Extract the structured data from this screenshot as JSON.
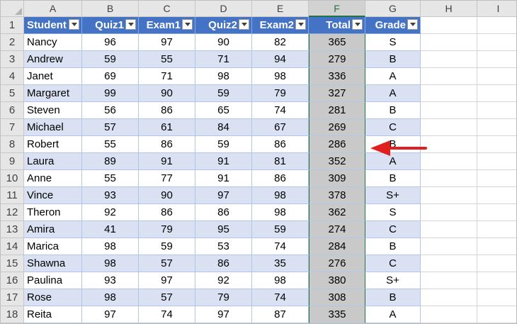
{
  "columns": [
    "A",
    "B",
    "C",
    "D",
    "E",
    "F",
    "G",
    "H",
    "I"
  ],
  "selected_column": "F",
  "headers": [
    "Student",
    "Quiz1",
    "Exam1",
    "Quiz2",
    "Exam2",
    "Total",
    "Grade"
  ],
  "rows": [
    {
      "n": "2",
      "name": "Nancy",
      "q1": "96",
      "e1": "97",
      "q2": "90",
      "e2": "82",
      "total": "365",
      "grade": "S"
    },
    {
      "n": "3",
      "name": "Andrew",
      "q1": "59",
      "e1": "55",
      "q2": "71",
      "e2": "94",
      "total": "279",
      "grade": "B"
    },
    {
      "n": "4",
      "name": "Janet",
      "q1": "69",
      "e1": "71",
      "q2": "98",
      "e2": "98",
      "total": "336",
      "grade": "A"
    },
    {
      "n": "5",
      "name": "Margaret",
      "q1": "99",
      "e1": "90",
      "q2": "59",
      "e2": "79",
      "total": "327",
      "grade": "A"
    },
    {
      "n": "6",
      "name": "Steven",
      "q1": "56",
      "e1": "86",
      "q2": "65",
      "e2": "74",
      "total": "281",
      "grade": "B"
    },
    {
      "n": "7",
      "name": "Michael",
      "q1": "57",
      "e1": "61",
      "q2": "84",
      "e2": "67",
      "total": "269",
      "grade": "C"
    },
    {
      "n": "8",
      "name": "Robert",
      "q1": "55",
      "e1": "86",
      "q2": "59",
      "e2": "86",
      "total": "286",
      "grade": "B"
    },
    {
      "n": "9",
      "name": "Laura",
      "q1": "89",
      "e1": "91",
      "q2": "91",
      "e2": "81",
      "total": "352",
      "grade": "A"
    },
    {
      "n": "10",
      "name": "Anne",
      "q1": "55",
      "e1": "77",
      "q2": "91",
      "e2": "86",
      "total": "309",
      "grade": "B"
    },
    {
      "n": "11",
      "name": "Vince",
      "q1": "93",
      "e1": "90",
      "q2": "97",
      "e2": "98",
      "total": "378",
      "grade": "S+"
    },
    {
      "n": "12",
      "name": "Theron",
      "q1": "92",
      "e1": "86",
      "q2": "86",
      "e2": "98",
      "total": "362",
      "grade": "S"
    },
    {
      "n": "13",
      "name": "Amira",
      "q1": "41",
      "e1": "79",
      "q2": "95",
      "e2": "59",
      "total": "274",
      "grade": "C"
    },
    {
      "n": "14",
      "name": "Marica",
      "q1": "98",
      "e1": "59",
      "q2": "53",
      "e2": "74",
      "total": "284",
      "grade": "B"
    },
    {
      "n": "15",
      "name": "Shawna",
      "q1": "98",
      "e1": "57",
      "q2": "86",
      "e2": "35",
      "total": "276",
      "grade": "C"
    },
    {
      "n": "16",
      "name": "Paulina",
      "q1": "93",
      "e1": "97",
      "q2": "92",
      "e2": "98",
      "total": "380",
      "grade": "S+"
    },
    {
      "n": "17",
      "name": "Rose",
      "q1": "98",
      "e1": "57",
      "q2": "79",
      "e2": "74",
      "total": "308",
      "grade": "B"
    },
    {
      "n": "18",
      "name": "Reita",
      "q1": "97",
      "e1": "74",
      "q2": "97",
      "e2": "87",
      "total": "335",
      "grade": "A"
    }
  ],
  "colors": {
    "header_fill": "#4472c4",
    "band_fill": "#d9e1f2",
    "selected_fill": "#c9c9c9",
    "arrow": "#e02020",
    "excel_green": "#217346"
  },
  "annotation": {
    "type": "arrow",
    "icon": "red-arrow-icon",
    "points_to": "F8"
  }
}
